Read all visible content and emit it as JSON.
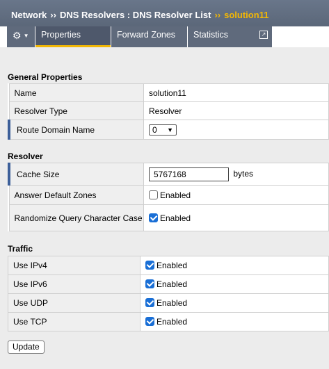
{
  "breadcrumb": {
    "part1": "Network",
    "sep": "››",
    "part2": "DNS Resolvers : DNS Resolver List",
    "current": "solution11"
  },
  "tabs": {
    "gear_icon": "gear-icon",
    "properties": "Properties",
    "forward_zones": "Forward Zones",
    "statistics": "Statistics",
    "ext_icon": "external-link-icon"
  },
  "general": {
    "title": "General Properties",
    "name_label": "Name",
    "name_value": "solution11",
    "type_label": "Resolver Type",
    "type_value": "Resolver",
    "route_label": "Route Domain Name",
    "route_value": "0"
  },
  "resolver": {
    "title": "Resolver",
    "cache_label": "Cache Size",
    "cache_value": "5767168",
    "cache_unit": "bytes",
    "answer_label": "Answer Default Zones",
    "answer_value": "Enabled",
    "answer_checked": false,
    "randomize_label": "Randomize Query Character Case",
    "randomize_value": "Enabled",
    "randomize_checked": true
  },
  "traffic": {
    "title": "Traffic",
    "rows": [
      {
        "label": "Use IPv4",
        "value": "Enabled",
        "checked": true
      },
      {
        "label": "Use IPv6",
        "value": "Enabled",
        "checked": true
      },
      {
        "label": "Use UDP",
        "value": "Enabled",
        "checked": true
      },
      {
        "label": "Use TCP",
        "value": "Enabled",
        "checked": true
      }
    ]
  },
  "actions": {
    "update": "Update"
  },
  "colors": {
    "accent": "#f2b705",
    "header": "#5f6a7c",
    "required_marker": "#3c5f99",
    "checkbox": "#1a6fd6"
  }
}
